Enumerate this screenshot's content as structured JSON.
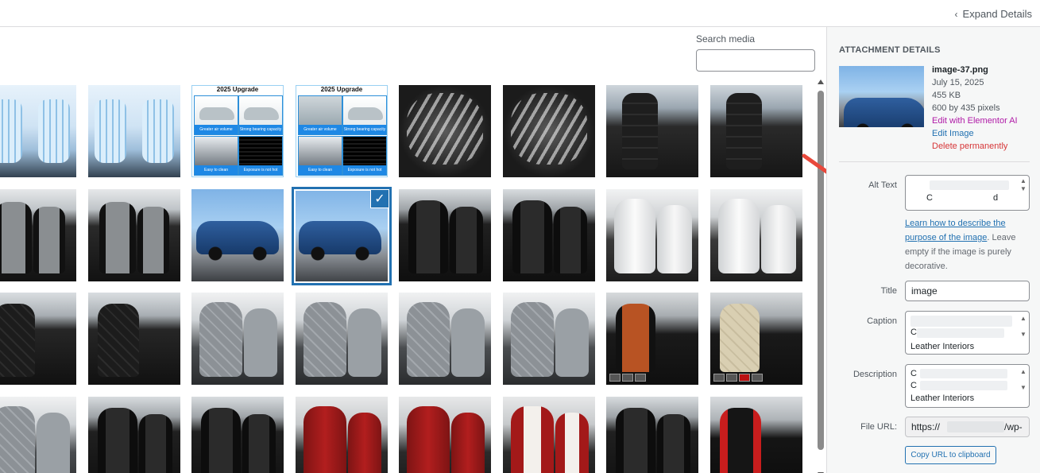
{
  "header": {
    "expand_label": "Expand Details"
  },
  "search": {
    "label": "Search media",
    "value": "",
    "placeholder": ""
  },
  "details": {
    "title": "ATTACHMENT DETAILS",
    "filename": "image-37.png",
    "date": "July 15, 2025",
    "size": "455 KB",
    "dimensions": "600 by 435 pixels",
    "edit_elementor": "Edit with Elementor AI",
    "edit_image": "Edit Image",
    "delete": "Delete permanently"
  },
  "fields": {
    "alt_label": "Alt Text",
    "alt_value_visible": "C",
    "alt_value_visible_2": "d",
    "help_link": "Learn how to describe the purpose of the image",
    "help_rest": ". Leave empty if the image is purely decorative.",
    "title_label": "Title",
    "title_value": "image",
    "caption_label": "Caption",
    "caption_value_visible": "C",
    "caption_value_visible_2": "Leather Interiors",
    "description_label": "Description",
    "description_value_visible": "C",
    "description_value_visible_2": "C",
    "description_value_visible_3": "Leather Interiors",
    "file_url_label": "File URL:",
    "file_url_start": "https://",
    "file_url_end": "/wp-",
    "copy_button": "Copy URL to clipboard"
  },
  "grid": {
    "upgrade_title": "2025 Upgrade",
    "captions": [
      "Greater air volume",
      "Strong bearing capacity",
      "Easy to clean",
      "Exposure is not hot"
    ],
    "tiles": [
      "seat-blue",
      "seat-blue",
      "upgrade",
      "upgrade",
      "air",
      "air",
      "black-door",
      "black-door",
      "grey-insert",
      "grey-insert",
      "suv",
      "suv-selected",
      "black-leather",
      "black-leather",
      "white",
      "white",
      "diamond",
      "diamond",
      "grey-seat",
      "grey-seat",
      "grey-seat",
      "grey-seat",
      "orange",
      "beige",
      "grey-seat",
      "black-leather",
      "black-leather",
      "red",
      "red",
      "red-white",
      "black-leather",
      "red-black"
    ],
    "selected_index": 11
  },
  "colors": {
    "accent": "#2271b1",
    "delete": "#d63638",
    "elementor": "#b01aa7",
    "arrow": "#e8483b"
  }
}
